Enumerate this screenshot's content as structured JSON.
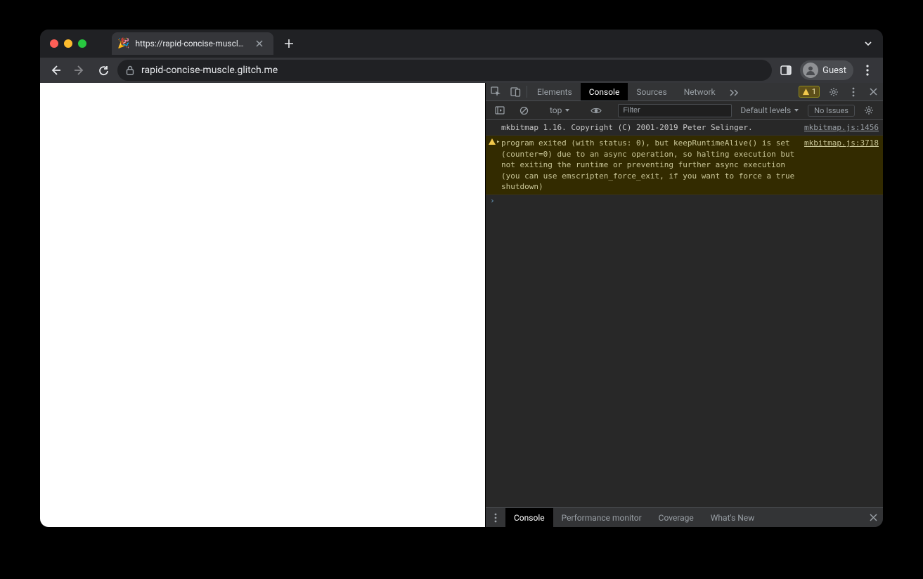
{
  "tab": {
    "title": "https://rapid-concise-muscle.g",
    "favicon": "🎉"
  },
  "address": "rapid-concise-muscle.glitch.me",
  "profile_label": "Guest",
  "devtools": {
    "tabs": [
      "Elements",
      "Console",
      "Sources",
      "Network"
    ],
    "active_tab": "Console",
    "warning_count": "1",
    "context": "top",
    "filter_placeholder": "Filter",
    "levels_label": "Default levels",
    "issues_label": "No Issues",
    "logs": [
      {
        "type": "log",
        "message": "mkbitmap 1.16. Copyright (C) 2001-2019 Peter Selinger.",
        "source": "mkbitmap.js:1456"
      },
      {
        "type": "warn",
        "message": "program exited (with status: 0), but keepRuntimeAlive() is set (counter=0) due to an async operation, so halting execution but not exiting the runtime or preventing further async execution (you can use emscripten_force_exit, if you want to force a true shutdown)",
        "source": "mkbitmap.js:3718"
      }
    ],
    "drawer_tabs": [
      "Console",
      "Performance monitor",
      "Coverage",
      "What's New"
    ],
    "drawer_active": "Console"
  }
}
